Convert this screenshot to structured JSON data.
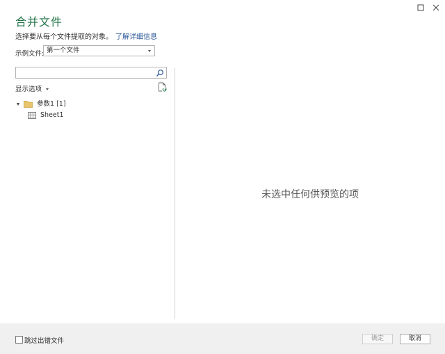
{
  "window": {
    "maximize_icon": "maximize-icon",
    "close_icon": "close-icon"
  },
  "header": {
    "title": "合并文件",
    "subtitle": "选择要从每个文件提取的对象。",
    "learn_more": "了解详细信息"
  },
  "sample_file": {
    "label": "示例文件:",
    "selected": "第一个文件"
  },
  "navigator": {
    "search_value": "",
    "display_options_label": "显示选项",
    "tree": {
      "folder_label": "参数1 [1]",
      "folder_icon": "folder-icon",
      "sheet_label": "Sheet1",
      "sheet_icon": "table-icon"
    }
  },
  "preview": {
    "empty_text": "未选中任何供预览的项"
  },
  "footer": {
    "skip_errors_label": "跳过出错文件",
    "skip_errors_checked": false,
    "ok_label": "确定",
    "cancel_label": "取消"
  },
  "colors": {
    "title": "#217346",
    "link": "#2b579a",
    "footer_bg": "#f0f0f0",
    "folder": "#e8c46a"
  }
}
